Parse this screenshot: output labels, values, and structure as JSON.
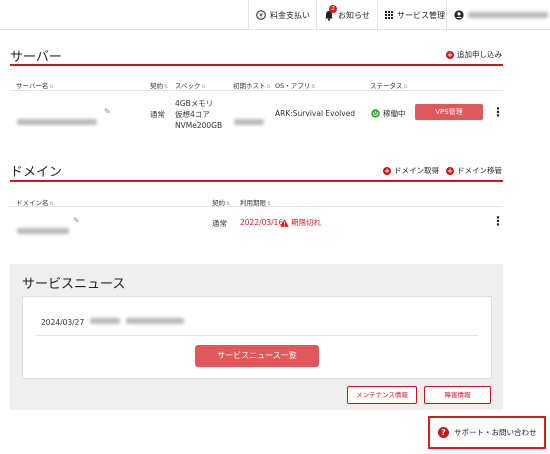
{
  "topnav": {
    "billing_label": "料金支払い",
    "notice_label": "お知らせ",
    "notice_badge": "2",
    "service_label": "サービス管理"
  },
  "server": {
    "title": "サーバー",
    "add_label": "追加申し込み",
    "columns": [
      "サーバー名",
      "契約",
      "スペック",
      "初期ホスト",
      "OS・アプリ",
      "ステータス"
    ],
    "row": {
      "contract": "通常",
      "spec": [
        "4GBメモリ",
        "仮想4コア",
        "NVMe200GB"
      ],
      "app": "ARK:Survival Evolved",
      "status": "稼働中",
      "button": "VPS管理"
    }
  },
  "domain": {
    "title": "ドメイン",
    "acquire_label": "ドメイン取得",
    "transfer_label": "ドメイン移管",
    "columns": [
      "ドメイン名",
      "契約",
      "利用期限"
    ],
    "row": {
      "contract": "通常",
      "expiry": "2022/03/16",
      "expired_label": "期限切れ"
    }
  },
  "news": {
    "title": "サービスニュース",
    "date": "2024/03/27",
    "list_button": "サービスニュース一覧",
    "maintenance_button": "メンテナンス情報",
    "failure_button": "障害情報"
  },
  "support": {
    "label": "サポート・お問い合わせ"
  },
  "colors": {
    "accent": "#c8161d",
    "button": "#e0575c",
    "status_green": "#2aa52f"
  }
}
